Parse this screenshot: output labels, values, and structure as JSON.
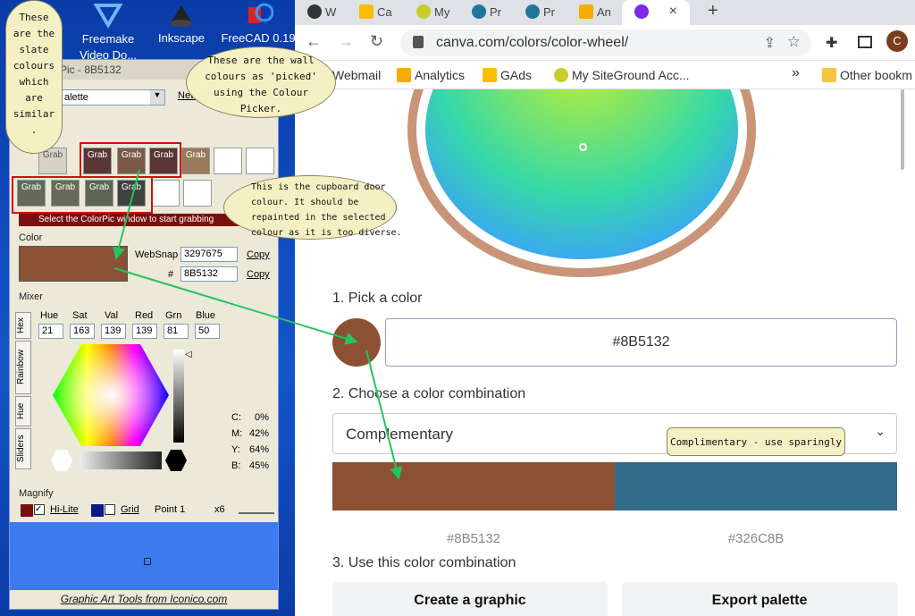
{
  "desktop": {
    "icons": [
      {
        "label": "Freemake\nVideo Do...",
        "icon": "freemake-icon"
      },
      {
        "label": "Inkscape",
        "icon": "inkscape-icon"
      },
      {
        "label": "FreeCAD 0.19",
        "icon": "freecad-icon"
      }
    ]
  },
  "colorpic": {
    "title": "Pic - 8B5132",
    "palette_select": "alette",
    "new_label": "New",
    "grab_label": "Grab",
    "status_bar": "Select the ColorPic window to start grabbing",
    "color_section": "Color",
    "current_color": "#8B5132",
    "websnap_label": "WebSnap",
    "websnap_value": "3297675",
    "hash_label": "#",
    "hex_value": "8B5132",
    "copy_label": "Copy",
    "mixer_section": "Mixer",
    "mixer_headers": [
      "Hue",
      "Sat",
      "Val",
      "Red",
      "Grn",
      "Blue"
    ],
    "mixer_values": [
      "21",
      "163",
      "139",
      "139",
      "81",
      "50"
    ],
    "side_tabs": [
      "Hex",
      "Rainbow",
      "Hue",
      "Sliders"
    ],
    "cmyk": [
      {
        "k": "C:",
        "v": "0%"
      },
      {
        "k": "M:",
        "v": "42%"
      },
      {
        "k": "Y:",
        "v": "64%"
      },
      {
        "k": "B:",
        "v": "45%"
      }
    ],
    "magnify_section": "Magnify",
    "hilite_label": "Hi-Lite",
    "grid_label": "Grid",
    "point_label": "Point 1",
    "zoom_label": "x6",
    "footer": "Graphic Art Tools from Iconico.com",
    "wall_swatches": [
      "#5a3636",
      "#7a5a45",
      "#5a3535",
      "#9a7a5a",
      "#ffffff",
      "#ffffff"
    ],
    "slate_swatches": [
      "#636a59",
      "#676a57",
      "#5e6452",
      "#3e4240",
      "#ffffff",
      "#ffffff",
      "#ffffff",
      "#ffffff"
    ],
    "colors": {
      "accent_red": "#7a0f0f",
      "navy": "#0a1a8a",
      "magnify_blue": "#3b7bef"
    }
  },
  "browser": {
    "tabs": [
      {
        "label": "W",
        "icon": "wordpress-icon"
      },
      {
        "label": "Ca",
        "icon": "google-ads-icon"
      },
      {
        "label": "My",
        "icon": "siteground-icon"
      },
      {
        "label": "Pr",
        "icon": "wordpress-icon"
      },
      {
        "label": "Pr",
        "icon": "wordpress-icon"
      },
      {
        "label": "An",
        "icon": "analytics-icon"
      },
      {
        "label": "",
        "icon": "canva-icon"
      }
    ],
    "close_tab": "×",
    "new_tab": "+",
    "url": "canva.com/colors/color-wheel/",
    "profile_initial": "C",
    "bookmarks": [
      {
        "label": "Webmail"
      },
      {
        "label": "Analytics",
        "icon": "analytics-icon"
      },
      {
        "label": "GAds",
        "icon": "google-ads-icon"
      },
      {
        "label": "My SiteGround Acc...",
        "icon": "siteground-icon"
      }
    ],
    "bookmarks_overflow": "»",
    "other_bookmarks": "Other bookm"
  },
  "page": {
    "step1": "1. Pick a color",
    "picked_hex": "#8B5132",
    "step2": "2. Choose a color combination",
    "combination": "Complementary",
    "swatch_left_hex": "#8B5132",
    "swatch_right_hex": "#326C8B",
    "step3": "3. Use this color combination",
    "create_btn": "Create a graphic",
    "export_btn": "Export palette",
    "colors": {
      "left": "#8B5132",
      "right": "#326C8B"
    }
  },
  "callouts": {
    "slate": "These\nare the\nslate\ncolours\nwhich\nare\nsimilar\n.",
    "wall": "These are the wall\ncolours as 'picked'\nusing the Colour\nPicker.",
    "door": "This is the cupboard door\ncolour. It should be\nrepainted in the selected\ncolour as it is too diverse.",
    "complimentary": "Complimentary - use sparingly"
  }
}
